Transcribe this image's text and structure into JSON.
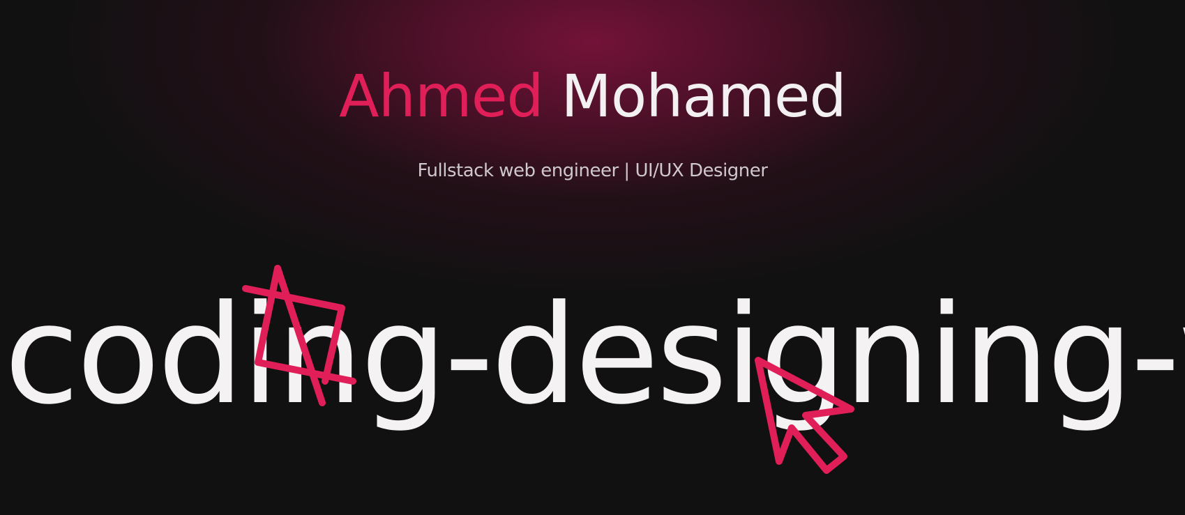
{
  "hero": {
    "first_name": "Ahmed",
    "last_name": "Mohamed",
    "tagline": "Fullstack web engineer | UI/UX Designer"
  },
  "marquee": {
    "text": "coding-designing-w"
  },
  "icons": {
    "crop": "crop-icon",
    "cursor": "cursor-arrow-icon"
  },
  "colors": {
    "accent": "#e01f59",
    "background": "#121112",
    "text": "#f2f0f1",
    "glow": "#78123a"
  }
}
